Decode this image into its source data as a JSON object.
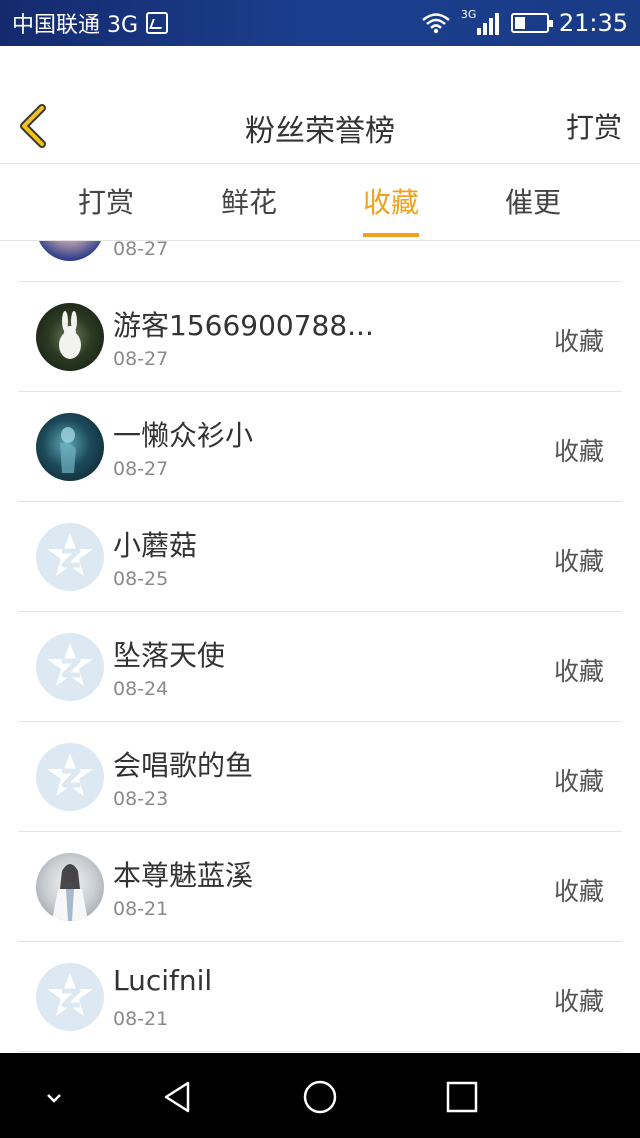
{
  "status_bar": {
    "carrier": "中国联通 3G",
    "network": "3G",
    "time": "21:35",
    "icons": [
      "sim-status-icon",
      "wifi-icon",
      "signal-icon",
      "battery-icon"
    ]
  },
  "header": {
    "title": "粉丝荣誉榜",
    "back_icon": "chevron-left-icon",
    "action_label": "打赏"
  },
  "tabs": [
    {
      "label": "打赏",
      "active": false
    },
    {
      "label": "鲜花",
      "active": false
    },
    {
      "label": "收藏",
      "active": true
    },
    {
      "label": "催更",
      "active": false
    }
  ],
  "accent_color": "#f2a11c",
  "list": {
    "items": [
      {
        "name": "",
        "date": "08-27",
        "action": "",
        "avatar": "photo"
      },
      {
        "name": "游客1566900788...",
        "date": "08-27",
        "action": "收藏",
        "avatar": "photo"
      },
      {
        "name": "一懒众衫小",
        "date": "08-27",
        "action": "收藏",
        "avatar": "photo"
      },
      {
        "name": "小蘑菇",
        "date": "08-25",
        "action": "收藏",
        "avatar": "default-avatar-icon"
      },
      {
        "name": "坠落天使",
        "date": "08-24",
        "action": "收藏",
        "avatar": "default-avatar-icon"
      },
      {
        "name": "会唱歌的鱼",
        "date": "08-23",
        "action": "收藏",
        "avatar": "default-avatar-icon"
      },
      {
        "name": "本尊魅蓝溪",
        "date": "08-21",
        "action": "收藏",
        "avatar": "photo"
      },
      {
        "name": "Lucifnil",
        "date": "08-21",
        "action": "收藏",
        "avatar": "default-avatar-icon"
      }
    ]
  },
  "nav_bar": {
    "buttons": [
      "collapse-icon",
      "back-triangle-icon",
      "home-circle-icon",
      "recents-square-icon"
    ]
  }
}
